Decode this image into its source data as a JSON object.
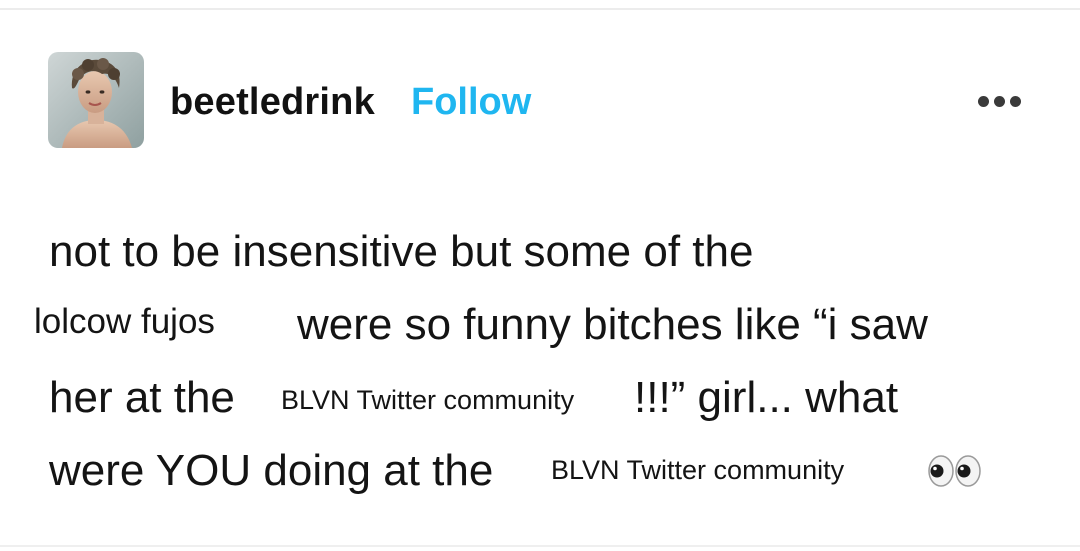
{
  "post": {
    "author": {
      "username": "beetledrink",
      "follow_label": "Follow",
      "avatar_icon": "portrait-avatar"
    },
    "menu_icon": "more-horizontal-icon",
    "body": {
      "line1": "not to be insensitive but some of the",
      "line2_insert": "lolcow fujos",
      "line2": "were so funny bitches like “i saw",
      "line3_start": "her at the",
      "line3_insert": "BLVN Twitter community",
      "line3_end": "!!!” girl... what",
      "line4_start": "were YOU doing at the",
      "line4_insert": "BLVN Twitter community",
      "line4_emoji_icon": "eyes-emoji-icon"
    },
    "colors": {
      "follow": "#1fb6f0",
      "text": "#141414"
    }
  }
}
